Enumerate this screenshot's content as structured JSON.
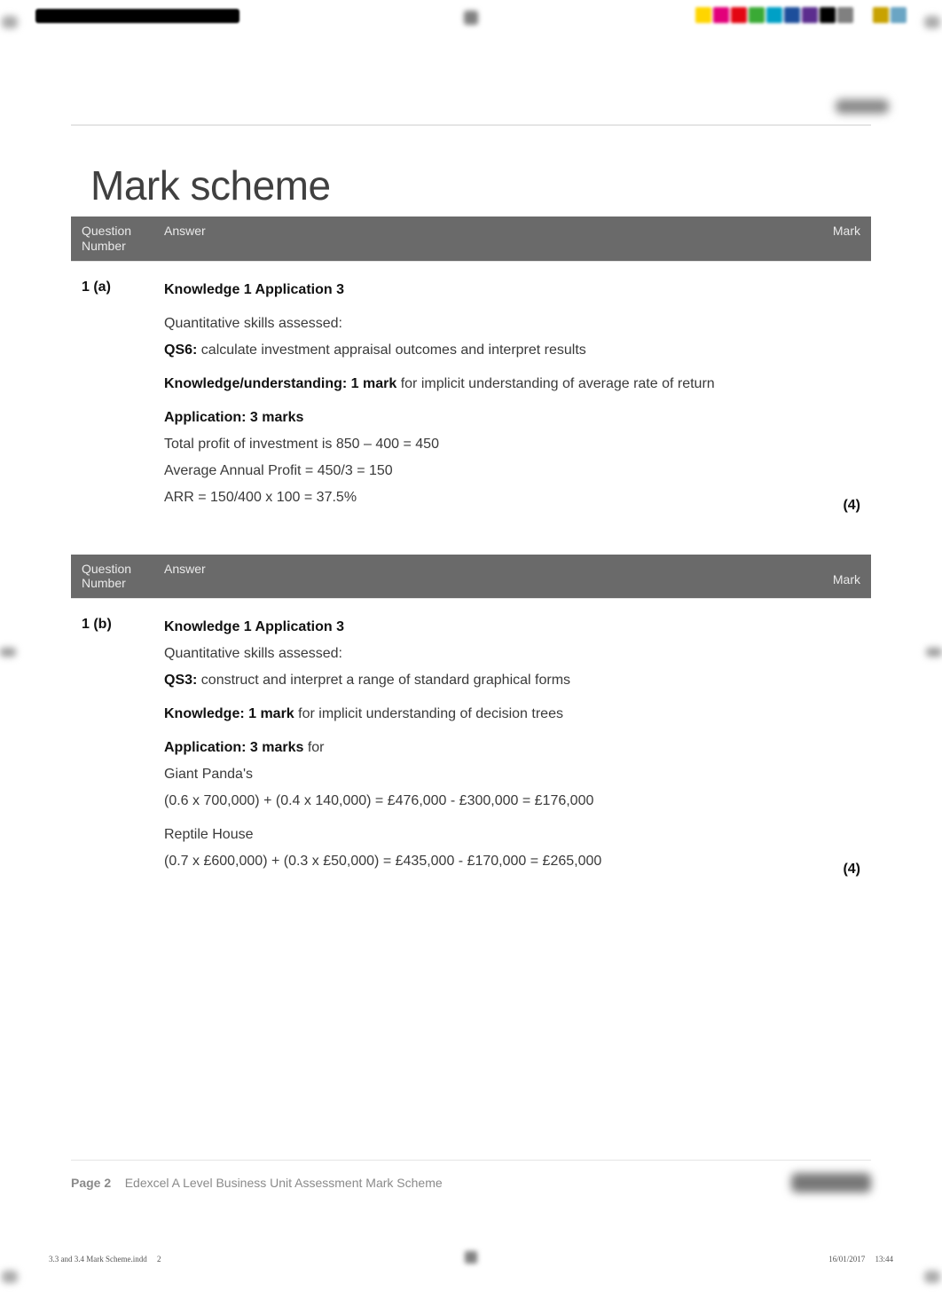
{
  "page_title": "Mark scheme",
  "color_swatches": [
    "#ffd500",
    "#e2007a",
    "#e30613",
    "#3aaa35",
    "#00a0c6",
    "#1d4e9b",
    "#5b2d8e",
    "#000000",
    "#808080",
    "#ffffff",
    "#c8a200",
    "#6aa5c4"
  ],
  "tables": [
    {
      "header": {
        "q": "Question\nNumber",
        "a": "Answer",
        "m": "Mark"
      },
      "rows": [
        {
          "qnum": "1 (a)",
          "mark": "(4)",
          "heading": "Knowledge 1 Application 3",
          "skills_label": "Quantitative skills assessed:",
          "qs_code": "QS6:",
          "qs_text": " calculate investment appraisal outcomes and interpret results",
          "knowledge_label": "Knowledge/understanding: 1 mark",
          "knowledge_text": " for implicit understanding of average rate of return",
          "application_label": "Application: 3 marks",
          "calc_lines": [
            "Total profit of investment is 850 – 400 = 450",
            "Average Annual Profit = 450/3 = 150",
            "ARR = 150/400 x 100 = 37.5%"
          ]
        }
      ]
    },
    {
      "header": {
        "q": "Question\nNumber",
        "a": "Answer",
        "m": "Mark"
      },
      "rows": [
        {
          "qnum": "1 (b)",
          "mark": "(4)",
          "heading": "Knowledge 1 Application 3",
          "skills_label": "Quantitative skills assessed:",
          "qs_code": "QS3:",
          "qs_text": " construct and interpret a range of standard graphical forms",
          "knowledge_label": "Knowledge: 1 mark",
          "knowledge_text": " for implicit understanding of decision trees",
          "application_label": "Application: 3 marks",
          "application_suffix": " for",
          "calc_blocks": [
            {
              "title": "Giant Panda's",
              "line": "(0.6 x 700,000) + (0.4 x 140,000) = £476,000 - £300,000 = £176,000"
            },
            {
              "title": "Reptile House",
              "line": "(0.7 x £600,000) + (0.3 x £50,000) = £435,000 - £170,000 = £265,000"
            }
          ]
        }
      ]
    }
  ],
  "footer": {
    "page_label": "Page 2",
    "doc_title": "Edexcel A Level Business Unit Assessment Mark Scheme"
  },
  "print_meta": {
    "file": "3.3 and 3.4 Mark Scheme.indd",
    "page": "2",
    "date": "16/01/2017",
    "time": "13:44"
  }
}
